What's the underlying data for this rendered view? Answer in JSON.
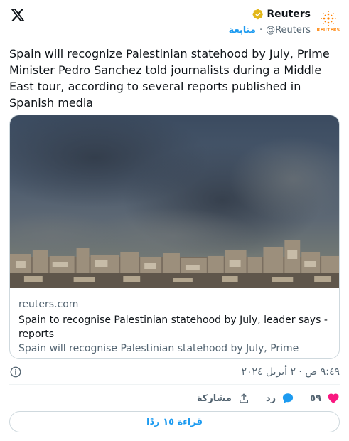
{
  "header": {
    "account_name": "Reuters",
    "handle": "@Reuters",
    "follow_label": "متابعة",
    "separator": "·",
    "avatar_word": "REUTERS",
    "logo_icon": "x-logo-icon",
    "verified_icon": "verified-badge-icon",
    "verified_color": "#e2b719"
  },
  "tweet": {
    "text": "Spain will recognize Palestinian statehood by July, Prime Minister Pedro Sanchez told journalists during a Middle East tour, according to several reports published in Spanish media"
  },
  "card": {
    "domain": "reuters.com",
    "title": "Spain to recognise Palestinian statehood by July, leader says -reports",
    "description": "Spain will recognise Palestinian statehood by July, Prime Minister Pedro Sanchez told journalists during a Middle East tour, according to several ..."
  },
  "meta": {
    "timestamp": "٩:٤٩ ص · ٢ أبريل ٢٠٢٤",
    "info_icon": "info-icon"
  },
  "actions": {
    "like_count": "٥٩",
    "reply_label": "رد",
    "share_label": "مشاركة",
    "like_color": "#f91880",
    "reply_color": "#1d9bf0"
  },
  "replies_button": {
    "label": "قراءة ١٥ ردًا"
  }
}
